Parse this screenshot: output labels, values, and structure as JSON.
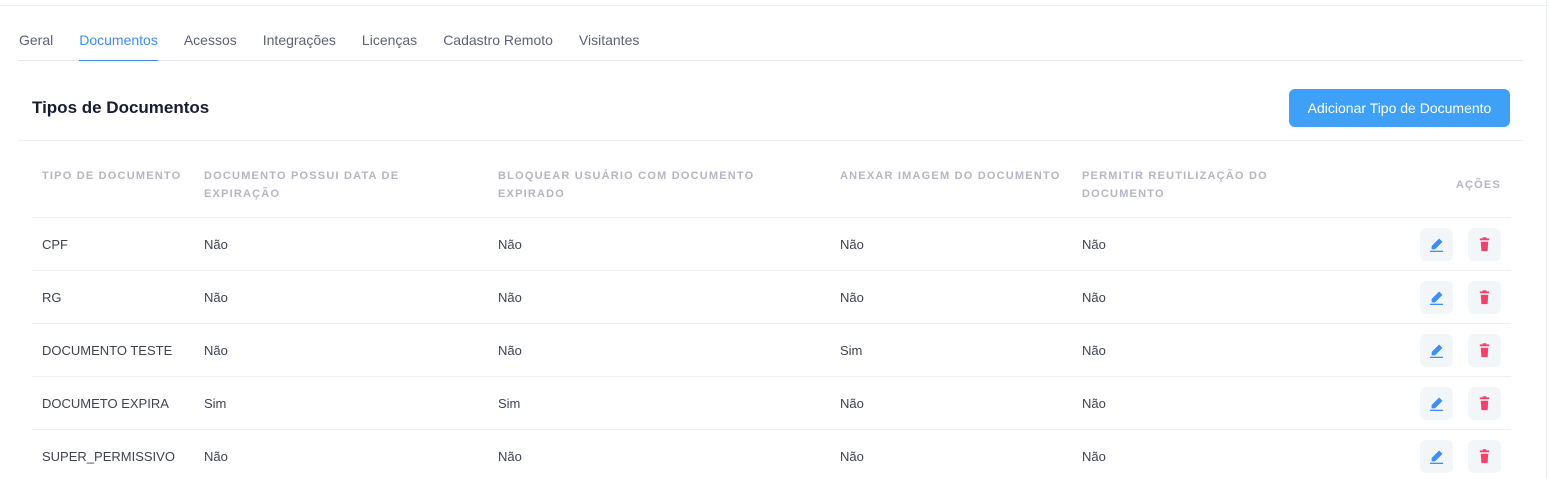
{
  "tabs": [
    {
      "label": "Geral",
      "active": false
    },
    {
      "label": "Documentos",
      "active": true
    },
    {
      "label": "Acessos",
      "active": false
    },
    {
      "label": "Integrações",
      "active": false
    },
    {
      "label": "Licenças",
      "active": false
    },
    {
      "label": "Cadastro Remoto",
      "active": false
    },
    {
      "label": "Visitantes",
      "active": false
    }
  ],
  "card": {
    "title": "Tipos de Documentos",
    "add_button_label": "Adicionar Tipo de Documento"
  },
  "table": {
    "columns": [
      "Tipo de Documento",
      "Documento possui data de expiração",
      "Bloquear usuário com documento expirado",
      "Anexar imagem do documento",
      "Permitir reutilização do documento",
      "Ações"
    ],
    "rows": [
      {
        "tipo": "CPF",
        "expiracao": "Não",
        "bloquear": "Não",
        "anexar": "Não",
        "reutilizacao": "Não"
      },
      {
        "tipo": "RG",
        "expiracao": "Não",
        "bloquear": "Não",
        "anexar": "Não",
        "reutilizacao": "Não"
      },
      {
        "tipo": "DOCUMENTO TESTE",
        "expiracao": "Não",
        "bloquear": "Não",
        "anexar": "Sim",
        "reutilizacao": "Não"
      },
      {
        "tipo": "DOCUMETO EXPIRA",
        "expiracao": "Sim",
        "bloquear": "Sim",
        "anexar": "Não",
        "reutilizacao": "Não"
      },
      {
        "tipo": "SUPER_PERMISSIVO",
        "expiracao": "Não",
        "bloquear": "Não",
        "anexar": "Não",
        "reutilizacao": "Não"
      }
    ],
    "actions": {
      "edit_icon": "edit-icon",
      "delete_icon": "trash-icon"
    }
  },
  "colors": {
    "accent": "#3e8ef7",
    "button": "#3ea0f6",
    "edit": "#3e8ef7",
    "delete": "#f1416c"
  }
}
